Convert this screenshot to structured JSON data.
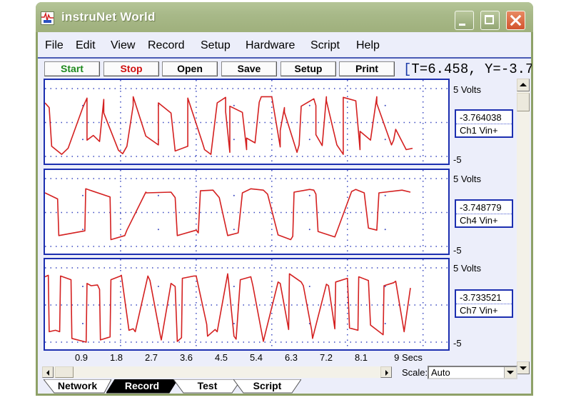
{
  "window": {
    "title": "instruNet World",
    "controls": [
      "minimize",
      "maximize",
      "close"
    ]
  },
  "menu": [
    {
      "label": "File",
      "mnemonic": "F"
    },
    {
      "label": "Edit",
      "mnemonic": "E"
    },
    {
      "label": "View",
      "mnemonic": "V"
    },
    {
      "label": "Record",
      "mnemonic": "R"
    },
    {
      "label": "Setup",
      "mnemonic": "S"
    },
    {
      "label": "Hardware",
      "mnemonic": "H"
    },
    {
      "label": "Script",
      "mnemonic": "p"
    },
    {
      "label": "Help",
      "mnemonic": ""
    }
  ],
  "toolbar": {
    "buttons": [
      {
        "label": "Start",
        "color": "#1e8a1e"
      },
      {
        "label": "Stop",
        "color": "#d01010"
      },
      {
        "label": "Open",
        "color": "#000000"
      },
      {
        "label": "Save",
        "color": "#000000"
      },
      {
        "label": "Setup",
        "color": "#000000"
      },
      {
        "label": "Print",
        "color": "#000000"
      }
    ],
    "readout": "T=6.458, Y=-3.7"
  },
  "channels": [
    {
      "name": "Ch1 Vin+",
      "value": "-3.764038",
      "ymax_label": "5 Volts",
      "ymin_label": "-5"
    },
    {
      "name": "Ch4 Vin+",
      "value": "-3.748779",
      "ymax_label": "5 Volts",
      "ymin_label": "-5"
    },
    {
      "name": "Ch7 Vin+",
      "value": "-3.733521",
      "ymax_label": "5 Volts",
      "ymin_label": "-5"
    }
  ],
  "x_axis": {
    "ticks": [
      "0.9",
      "1.8",
      "2.7",
      "3.6",
      "4.5",
      "5.4",
      "6.3",
      "7.2",
      "8.1",
      "9 Secs"
    ]
  },
  "scale": {
    "label": "Scale:",
    "value": "Auto"
  },
  "tabs": [
    {
      "label": "Network",
      "active": false
    },
    {
      "label": "Record",
      "active": true
    },
    {
      "label": "Test",
      "active": false
    },
    {
      "label": "Script",
      "active": false
    }
  ],
  "colors": {
    "trace": "#d42020",
    "plot_border": "#1c2fb0",
    "grid": "#3a48c0"
  },
  "chart_data": [
    {
      "type": "line",
      "title": "Ch1 Vin+",
      "xlabel": "Secs",
      "ylabel": "Volts",
      "xlim": [
        0,
        9.6
      ],
      "ylim": [
        -5,
        5
      ],
      "grid": true,
      "x": [
        0,
        0.1,
        0.16,
        0.4,
        0.55,
        0.9,
        1.0,
        1.0,
        1.15,
        1.3,
        1.4,
        1.4,
        1.75,
        1.85,
        1.95,
        2.1,
        2.1,
        2.4,
        2.7,
        2.7,
        3.0,
        3.1,
        3.4,
        3.4,
        3.75,
        3.8,
        3.95,
        4.1,
        4.3,
        4.3,
        4.4,
        4.4,
        4.7,
        4.8,
        4.8,
        5.0,
        5.1,
        5.15,
        5.4,
        5.6,
        5.6,
        5.7,
        5.7,
        6.0,
        6.05,
        6.1,
        6.4,
        6.45,
        6.45,
        6.6,
        6.7,
        6.7,
        6.95,
        7.1,
        7.1,
        7.4,
        7.5,
        7.5,
        7.75,
        7.9,
        7.9,
        8.25,
        8.3,
        8.35,
        8.6,
        8.75
      ],
      "y": [
        2.9,
        2.2,
        -3.5,
        -4.7,
        -3.8,
        2.2,
        3.6,
        -2.6,
        -1.9,
        -2.8,
        3.4,
        1.4,
        -4.1,
        -4.6,
        -3.5,
        2.5,
        3.8,
        -2.0,
        -3.3,
        2.9,
        1.4,
        -4.2,
        -3.5,
        3.6,
        -3.0,
        -4.0,
        -4.7,
        2.9,
        3.7,
        1.6,
        -4.4,
        2.4,
        1.5,
        -4.0,
        -2.3,
        -3.0,
        3.0,
        3.8,
        3.8,
        -3.6,
        -1.2,
        2.2,
        1.5,
        -4.4,
        -3.3,
        2.4,
        3.5,
        2.5,
        -1.8,
        -3.4,
        3.8,
        3.2,
        -3.3,
        -4.7,
        3.7,
        3.2,
        -4.0,
        -1.3,
        -2.6,
        3.8,
        2.8,
        -3.3,
        -2.6,
        -1.0,
        -4.0,
        -3.8
      ]
    },
    {
      "type": "line",
      "title": "Ch4 Vin+",
      "xlabel": "Secs",
      "ylabel": "Volts",
      "xlim": [
        0,
        9.6
      ],
      "ylim": [
        -5,
        5
      ],
      "grid": true,
      "x": [
        0,
        0.3,
        0.33,
        0.95,
        0.97,
        1.55,
        1.57,
        1.9,
        1.95,
        2.4,
        2.42,
        3.0,
        3.1,
        3.15,
        3.6,
        3.65,
        3.7,
        4.0,
        4.15,
        4.35,
        4.6,
        4.7,
        4.9,
        5.2,
        5.3,
        5.55,
        5.85,
        5.9,
        5.93,
        6.3,
        6.4,
        6.45,
        6.5,
        6.9,
        6.95,
        7.3,
        7.4,
        7.6,
        7.7,
        7.9,
        7.95,
        8.5,
        8.7
      ],
      "y": [
        2.9,
        2.0,
        -3.4,
        -2.7,
        3.5,
        2.3,
        -4.0,
        -3.4,
        -2.6,
        3.0,
        2.9,
        3.0,
        2.2,
        -3.4,
        -2.6,
        -3.0,
        3.2,
        3.3,
        2.2,
        -3.4,
        -3.0,
        2.9,
        3.5,
        3.3,
        2.7,
        -3.3,
        -4.0,
        -3.5,
        3.0,
        3.4,
        3.3,
        2.7,
        -2.8,
        -3.6,
        -2.8,
        3.1,
        3.4,
        2.9,
        -2.3,
        -2.6,
        2.9,
        3.3,
        3.0
      ]
    },
    {
      "type": "line",
      "title": "Ch7 Vin+",
      "xlabel": "Secs",
      "ylabel": "Volts",
      "xlim": [
        0,
        9.6
      ],
      "ylim": [
        -5,
        5
      ],
      "grid": true,
      "x": [
        0,
        0.08,
        0.1,
        0.25,
        0.35,
        0.37,
        0.62,
        0.64,
        0.98,
        1.0,
        1.1,
        1.25,
        1.3,
        1.32,
        1.55,
        1.57,
        1.8,
        1.82,
        2.0,
        2.1,
        2.15,
        2.45,
        2.5,
        2.75,
        2.77,
        3.0,
        3.1,
        3.15,
        3.25,
        3.27,
        3.55,
        3.6,
        3.85,
        3.87,
        4.05,
        4.1,
        4.35,
        4.37,
        4.5,
        4.55,
        4.65,
        4.9,
        4.95,
        5.2,
        5.22,
        5.55,
        5.6,
        5.8,
        5.82,
        6.1,
        6.15,
        6.35,
        6.37,
        6.7,
        6.75,
        6.9,
        6.92,
        7.2,
        7.25,
        7.45,
        7.47,
        7.7,
        7.75,
        8.05,
        8.07,
        8.3,
        8.35,
        8.55,
        8.7
      ],
      "y": [
        3.8,
        4.0,
        -3.6,
        -3.4,
        -3.6,
        3.9,
        3.4,
        -4.5,
        -5.0,
        2.9,
        2.6,
        2.7,
        2.1,
        -4.7,
        -4.3,
        3.4,
        3.9,
        4.0,
        -3.4,
        -3.2,
        -3.6,
        3.9,
        3.3,
        -4.2,
        -4.7,
        2.9,
        2.5,
        -4.9,
        -4.4,
        3.6,
        3.9,
        3.9,
        -2.6,
        -4.2,
        -3.3,
        -3.6,
        4.2,
        3.2,
        -4.2,
        -4.6,
        3.4,
        3.8,
        2.6,
        -4.9,
        -4.4,
        3.1,
        2.9,
        -3.3,
        4.2,
        3.1,
        2.6,
        -3.4,
        -4.5,
        2.8,
        2.6,
        -3.2,
        3.1,
        3.6,
        -3.1,
        -3.4,
        3.8,
        3.3,
        -2.7,
        -4.0,
        2.6,
        3.0,
        3.2,
        -3.6,
        2.3
      ]
    }
  ]
}
